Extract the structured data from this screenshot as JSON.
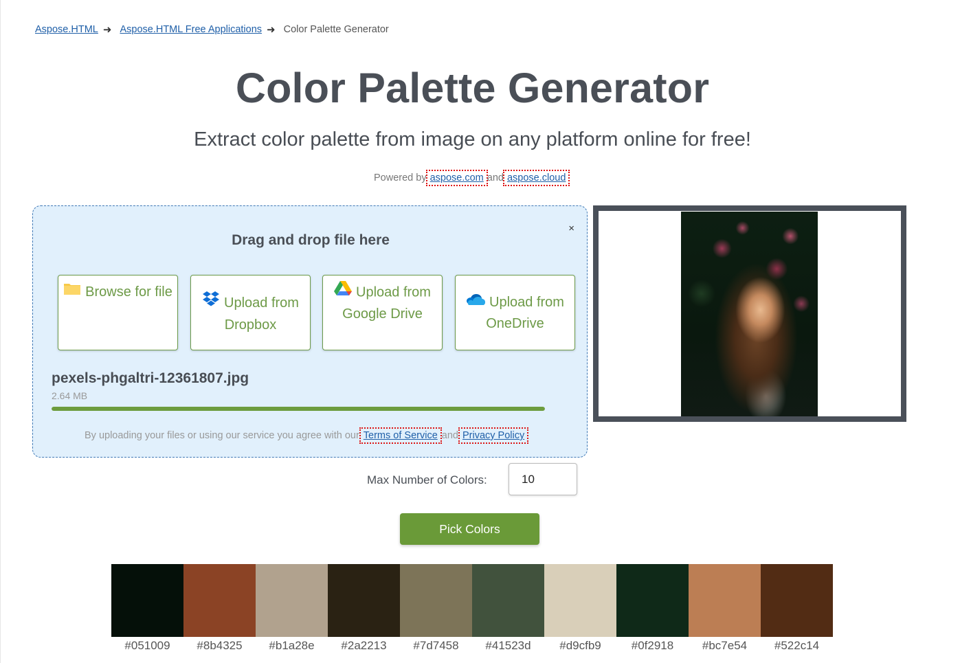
{
  "breadcrumb": {
    "items": [
      {
        "label": "Aspose.HTML"
      },
      {
        "label": "Aspose.HTML Free Applications"
      }
    ],
    "separator": "➜",
    "current": "Color Palette Generator"
  },
  "header": {
    "title": "Color Palette Generator",
    "subtitle": "Extract color palette from image on any platform online for free!"
  },
  "powered": {
    "prefix": "Powered by",
    "link1": "aspose.com",
    "conj": "and",
    "link2": "aspose.cloud"
  },
  "dropzone": {
    "title": "Drag and drop file here",
    "close_icon": "×",
    "buttons": [
      {
        "icon": "folder-icon",
        "label": "Browse for file"
      },
      {
        "icon": "dropbox-icon",
        "label": "Upload from Dropbox"
      },
      {
        "icon": "google-drive-icon",
        "label": "Upload from Google Drive"
      },
      {
        "icon": "onedrive-icon",
        "label": "Upload from OneDrive"
      }
    ],
    "file": {
      "name": "pexels-phgaltri-12361807.jpg",
      "size": "2.64 MB",
      "progress": 1.0
    },
    "agreement": {
      "text": "By uploading your files or using our service you agree with our",
      "terms": "Terms of Service",
      "conj": "and",
      "privacy": "Privacy Policy"
    }
  },
  "preview": {
    "description": "Uploaded photo: woman with long hair among flowering shrubs in sunlight"
  },
  "options": {
    "max_colors_label": "Max Number of Colors:",
    "max_colors_value": "10",
    "pick_button": "Pick Colors"
  },
  "palette": {
    "colors": [
      "#051009",
      "#8b4325",
      "#b1a28e",
      "#2a2213",
      "#7d7458",
      "#41523d",
      "#d9cfb9",
      "#0f2918",
      "#bc7e54",
      "#522c14"
    ]
  },
  "colors": {
    "accent_green": "#6a9a38",
    "link_blue": "#1f5fa8",
    "dropzone_bg": "#e1f0fc"
  }
}
